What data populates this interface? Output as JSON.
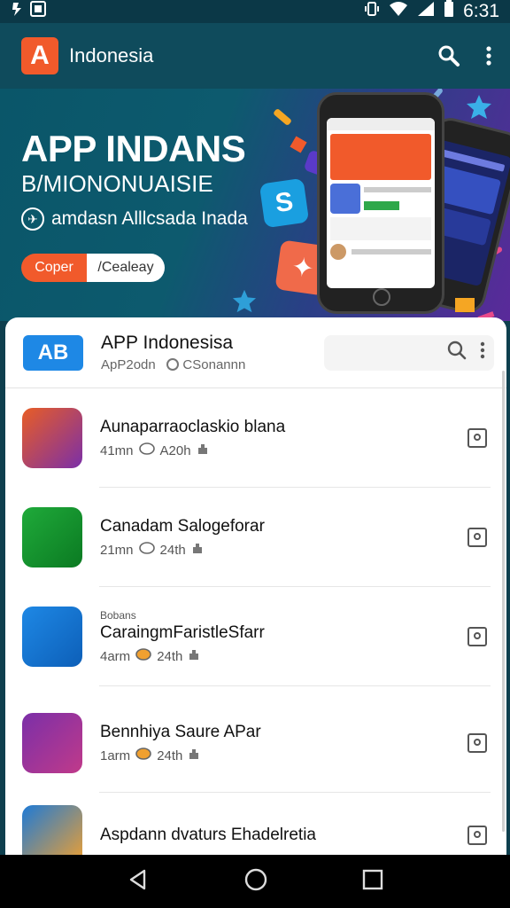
{
  "status_bar": {
    "left_icons": [
      "notification-icon",
      "photo-icon"
    ],
    "time": "6:31"
  },
  "app_bar": {
    "logo_text": "A",
    "title": "Indonesia"
  },
  "hero": {
    "title": "APP INDANS",
    "subtitle": "B/MIONONUAISIE",
    "tagline": "amdasn Alllcsada Inada",
    "toggle_left": "Coper",
    "toggle_right": "/Cealeay"
  },
  "card": {
    "logo_text": "AB",
    "title": "APP Indonesisa",
    "subtitle_part1": "ApP2odn",
    "subtitle_part2": "CSonannn"
  },
  "apps": [
    {
      "label": "",
      "name": "Aunaparraoclaskio blana",
      "size": "41mn",
      "rating": "A20h",
      "colors": [
        "#e85d25",
        "#7b2fa8"
      ]
    },
    {
      "label": "",
      "name": "Canadam Salogeforar",
      "size": "21mn",
      "rating": "24th",
      "colors": [
        "#1faa3a",
        "#0b7a22"
      ]
    },
    {
      "label": "Bobans",
      "name": "CaraingmFaristleSfarr",
      "size": "4arm",
      "rating": "24th",
      "colors": [
        "#1e88e5",
        "#0d5fb8"
      ]
    },
    {
      "label": "",
      "name": "Bennhiya Saure APar",
      "size": "1arm",
      "rating": "24th",
      "colors": [
        "#7b2fa8",
        "#c03a8a"
      ]
    },
    {
      "label": "",
      "name": "Aspdann dvaturs Ehadelretia",
      "size": "",
      "rating": "",
      "colors": [
        "#1e7ad6",
        "#f0a030"
      ]
    }
  ]
}
